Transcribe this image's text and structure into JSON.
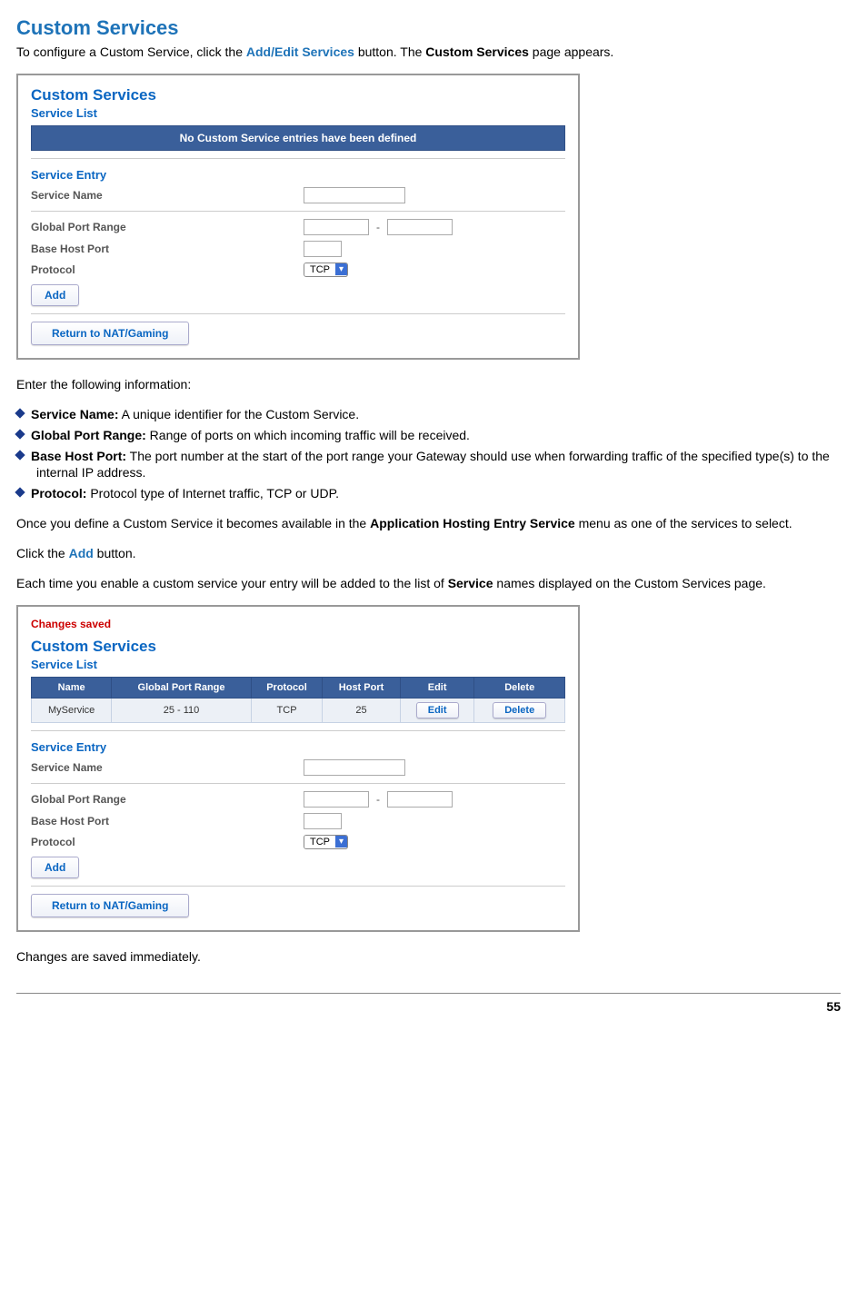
{
  "page": {
    "title": "Custom Services",
    "intro_pre": "To configure a Custom Service, click the ",
    "intro_link": "Add/Edit Services",
    "intro_mid": " button. The ",
    "intro_bold": "Custom Services",
    "intro_post": " page appears.",
    "enter_info": "Enter the following information:",
    "bullets": {
      "b1_label": "Service Name:",
      "b1_text": " A unique identifier for the Custom Service.",
      "b2_label": "Global Port Range:",
      "b2_text": " Range of ports on which incoming traffic will be received.",
      "b3_label": "Base Host Port:",
      "b3_text": " The port number at the start of the port range your Gateway should use when forwarding traffic of the specified type(s) to the internal IP address.",
      "b4_label": "Protocol:",
      "b4_text": " Protocol type of Internet traffic, TCP or UDP."
    },
    "once_pre": "Once you define a Custom Service it becomes available in the ",
    "once_bold": "Application Hosting Entry Service",
    "once_post": " menu as one of the services to select.",
    "click_pre": "Click the ",
    "click_link": "Add",
    "click_post": " button.",
    "each_pre": "Each time you enable a custom service your entry will be added to the list of ",
    "each_bold": "Service",
    "each_post": " names displayed on the Custom Services page.",
    "changes_saved": "Changes are saved immediately.",
    "page_number": "55"
  },
  "shot1": {
    "title": "Custom Services",
    "svc_list": "Service List",
    "empty_msg": "No Custom Service entries have been defined",
    "entry_title": "Service Entry",
    "labels": {
      "name": "Service Name",
      "range": "Global Port Range",
      "base": "Base Host Port",
      "protocol": "Protocol"
    },
    "protocol_value": "TCP",
    "add_btn": "Add",
    "return_btn": "Return to NAT/Gaming"
  },
  "shot2": {
    "changes": "Changes saved",
    "title": "Custom Services",
    "svc_list": "Service List",
    "headers": {
      "name": "Name",
      "range": "Global Port Range",
      "protocol": "Protocol",
      "host": "Host Port",
      "edit": "Edit",
      "delete": "Delete"
    },
    "row": {
      "name": "MyService",
      "range": "25 - 110",
      "protocol": "TCP",
      "host": "25",
      "edit": "Edit",
      "delete": "Delete"
    },
    "entry_title": "Service Entry",
    "labels": {
      "name": "Service Name",
      "range": "Global Port Range",
      "base": "Base Host Port",
      "protocol": "Protocol"
    },
    "protocol_value": "TCP",
    "add_btn": "Add",
    "return_btn": "Return to NAT/Gaming"
  }
}
